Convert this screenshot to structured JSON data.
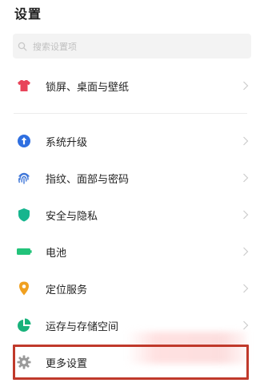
{
  "header": {
    "title": "设置"
  },
  "search": {
    "placeholder": "搜索设置项"
  },
  "items": [
    {
      "label": "锁屏、桌面与壁纸",
      "icon": "tshirt-icon",
      "color": "#e8445a"
    },
    {
      "label": "系统升级",
      "icon": "upgrade-arrow-icon",
      "color": "#2f6fe0"
    },
    {
      "label": "指纹、面部与密码",
      "icon": "fingerprint-icon",
      "color": "#3e76d8"
    },
    {
      "label": "安全与隐私",
      "icon": "shield-icon",
      "color": "#16b58e"
    },
    {
      "label": "电池",
      "icon": "battery-icon",
      "color": "#22c37a"
    },
    {
      "label": "定位服务",
      "icon": "location-pin-icon",
      "color": "#f0a020"
    },
    {
      "label": "运存与存储空间",
      "icon": "storage-pie-icon",
      "color": "#18b27b"
    },
    {
      "label": "更多设置",
      "icon": "gear-icon",
      "color": "#9a9a9a"
    }
  ],
  "colors": {
    "highlight_border": "#c0392b",
    "chevron": "#cccccc"
  }
}
